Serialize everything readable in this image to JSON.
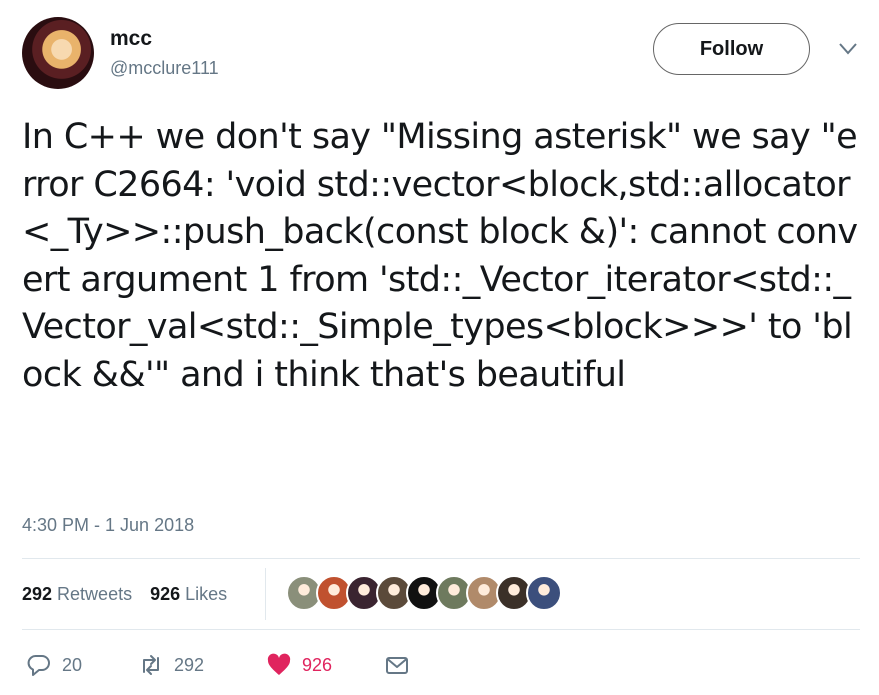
{
  "author": {
    "name": "mcc",
    "handle": "@mcclure111"
  },
  "header": {
    "follow_label": "Follow"
  },
  "tweet": {
    "text": "In C++ we don't say \"Missing asterisk\" we say \"error C2664: 'void std::vector<block,std::allocator<_Ty>>::push_back(const block &)': cannot convert argument 1 from 'std::_Vector_iterator<std::_Vector_val<std::_Simple_types<block>>>' to 'block &&'\" and i think that's beautiful",
    "timestamp": "4:30 PM - 1 Jun 2018"
  },
  "stats": {
    "retweets_count": "292",
    "retweets_label": "Retweets",
    "likes_count": "926",
    "likes_label": "Likes"
  },
  "likers": [
    {
      "color": "#8a8f7a"
    },
    {
      "color": "#c0512f"
    },
    {
      "color": "#3a2430"
    },
    {
      "color": "#5b4a3a"
    },
    {
      "color": "#111111"
    },
    {
      "color": "#6e7a5e"
    },
    {
      "color": "#b08a6a"
    },
    {
      "color": "#3b3028"
    },
    {
      "color": "#3c4f7c"
    }
  ],
  "actions": {
    "reply_count": "20",
    "retweet_count": "292",
    "like_count": "926"
  },
  "colors": {
    "like_accent": "#e0245e",
    "secondary_text": "#657786",
    "divider": "#e1e8ed"
  }
}
